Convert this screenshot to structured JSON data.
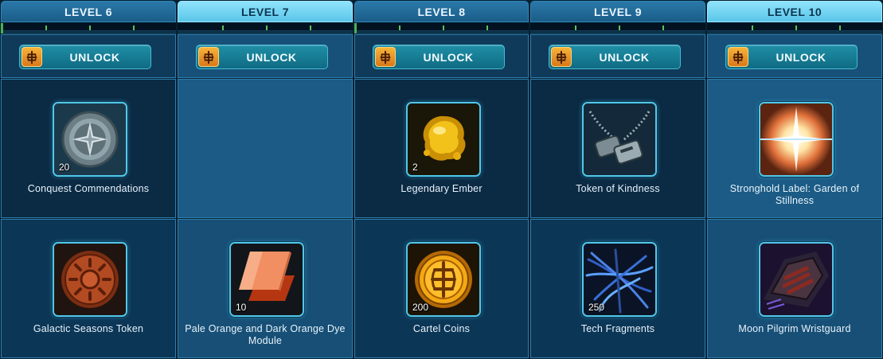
{
  "columns": [
    {
      "level_label": "LEVEL 6",
      "active": false,
      "unlock_label": "UNLOCK",
      "rewards": [
        {
          "name": "Conquest Commendations",
          "quantity": "20",
          "icon": "conquest-commendation-icon"
        },
        {
          "name": "Galactic Seasons Token",
          "quantity": "",
          "icon": "galactic-seasons-token-icon"
        }
      ]
    },
    {
      "level_label": "LEVEL 7",
      "active": true,
      "unlock_label": "UNLOCK",
      "rewards": [
        {
          "name": "",
          "quantity": "",
          "icon": ""
        },
        {
          "name": "Pale Orange and Dark Orange Dye Module",
          "quantity": "10",
          "icon": "dye-module-icon"
        }
      ]
    },
    {
      "level_label": "LEVEL 8",
      "active": false,
      "unlock_label": "UNLOCK",
      "rewards": [
        {
          "name": "Legendary Ember",
          "quantity": "2",
          "icon": "legendary-ember-icon"
        },
        {
          "name": "Cartel Coins",
          "quantity": "200",
          "icon": "cartel-coins-icon"
        }
      ]
    },
    {
      "level_label": "LEVEL 9",
      "active": false,
      "unlock_label": "UNLOCK",
      "rewards": [
        {
          "name": "Token of Kindness",
          "quantity": "",
          "icon": "dog-tags-icon"
        },
        {
          "name": "Tech Fragments",
          "quantity": "250",
          "icon": "tech-fragments-icon"
        }
      ]
    },
    {
      "level_label": "LEVEL 10",
      "active": true,
      "unlock_label": "UNLOCK",
      "rewards": [
        {
          "name": "Stronghold Label: Garden of Stillness",
          "quantity": "",
          "icon": "stronghold-label-icon"
        },
        {
          "name": "Moon Pilgrim Wristguard",
          "quantity": "",
          "icon": "wristguard-icon"
        }
      ]
    }
  ],
  "colors": {
    "header": "#1b5d89",
    "header_active": "#6fd2f0",
    "unlock_button": "#177d95",
    "cartel_coin": "#f0a02e",
    "frame": "#52c8ea",
    "progress_tick": "#58c25f"
  }
}
